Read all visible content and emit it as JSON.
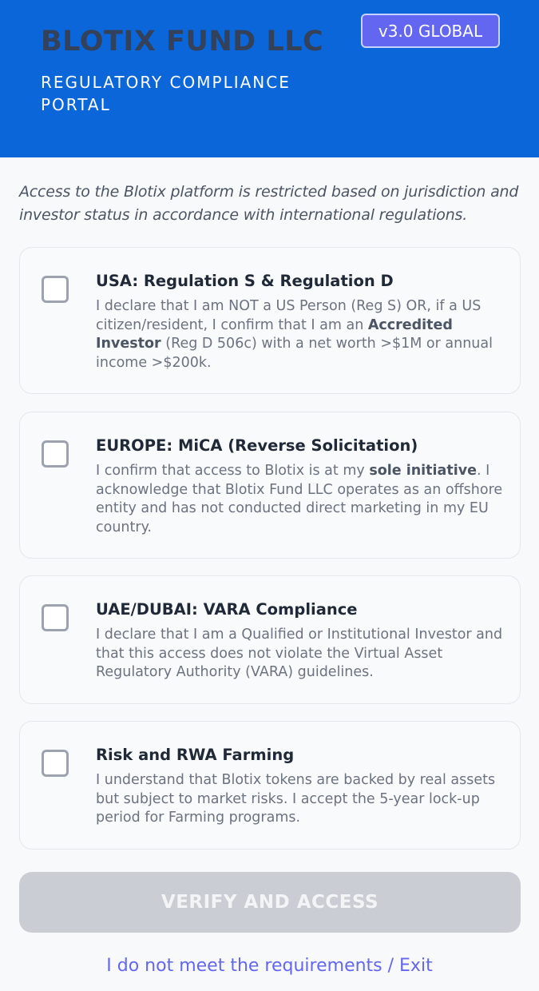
{
  "header": {
    "brand": "BLOTIX FUND LLC",
    "subtitle": "REGULATORY COMPLIANCE PORTAL",
    "version": "v3.0 GLOBAL"
  },
  "intro": "Access to the Blotix platform is restricted based on jurisdiction and investor status in accordance with international regulations.",
  "cards": [
    {
      "title": "USA: Regulation S & Regulation D",
      "desc_a": "I declare that I am NOT a US Person (Reg S) OR, if a US citizen/resident, I confirm that I am an ",
      "desc_bold": "Accredited Investor",
      "desc_b": " (Reg D 506c) with a net worth >$1M or annual income >$200k.",
      "checked": false
    },
    {
      "title": "EUROPE: MiCA (Reverse Solicitation)",
      "desc_a": "I confirm that access to Blotix is at my ",
      "desc_bold": "sole initiative",
      "desc_b": ". I acknowledge that Blotix Fund LLC operates as an offshore entity and has not conducted direct marketing in my EU country.",
      "checked": false
    },
    {
      "title": "UAE/DUBAI: VARA Compliance",
      "desc": "I declare that I am a Qualified or Institutional Investor and that this access does not violate the Virtual Asset Regulatory Authority (VARA) guidelines.",
      "checked": false
    },
    {
      "title": "Risk and RWA Farming",
      "desc": "I understand that Blotix tokens are backed by real assets but subject to market risks. I accept the 5-year lock-up period for Farming programs.",
      "checked": false
    }
  ],
  "actions": {
    "verify_label": "VERIFY AND ACCESS",
    "exit_label": "I do not meet the requirements / Exit"
  },
  "colors": {
    "header_bg": "#0b66d9",
    "accent": "#6366f1",
    "button_disabled": "#cbcdd4"
  }
}
